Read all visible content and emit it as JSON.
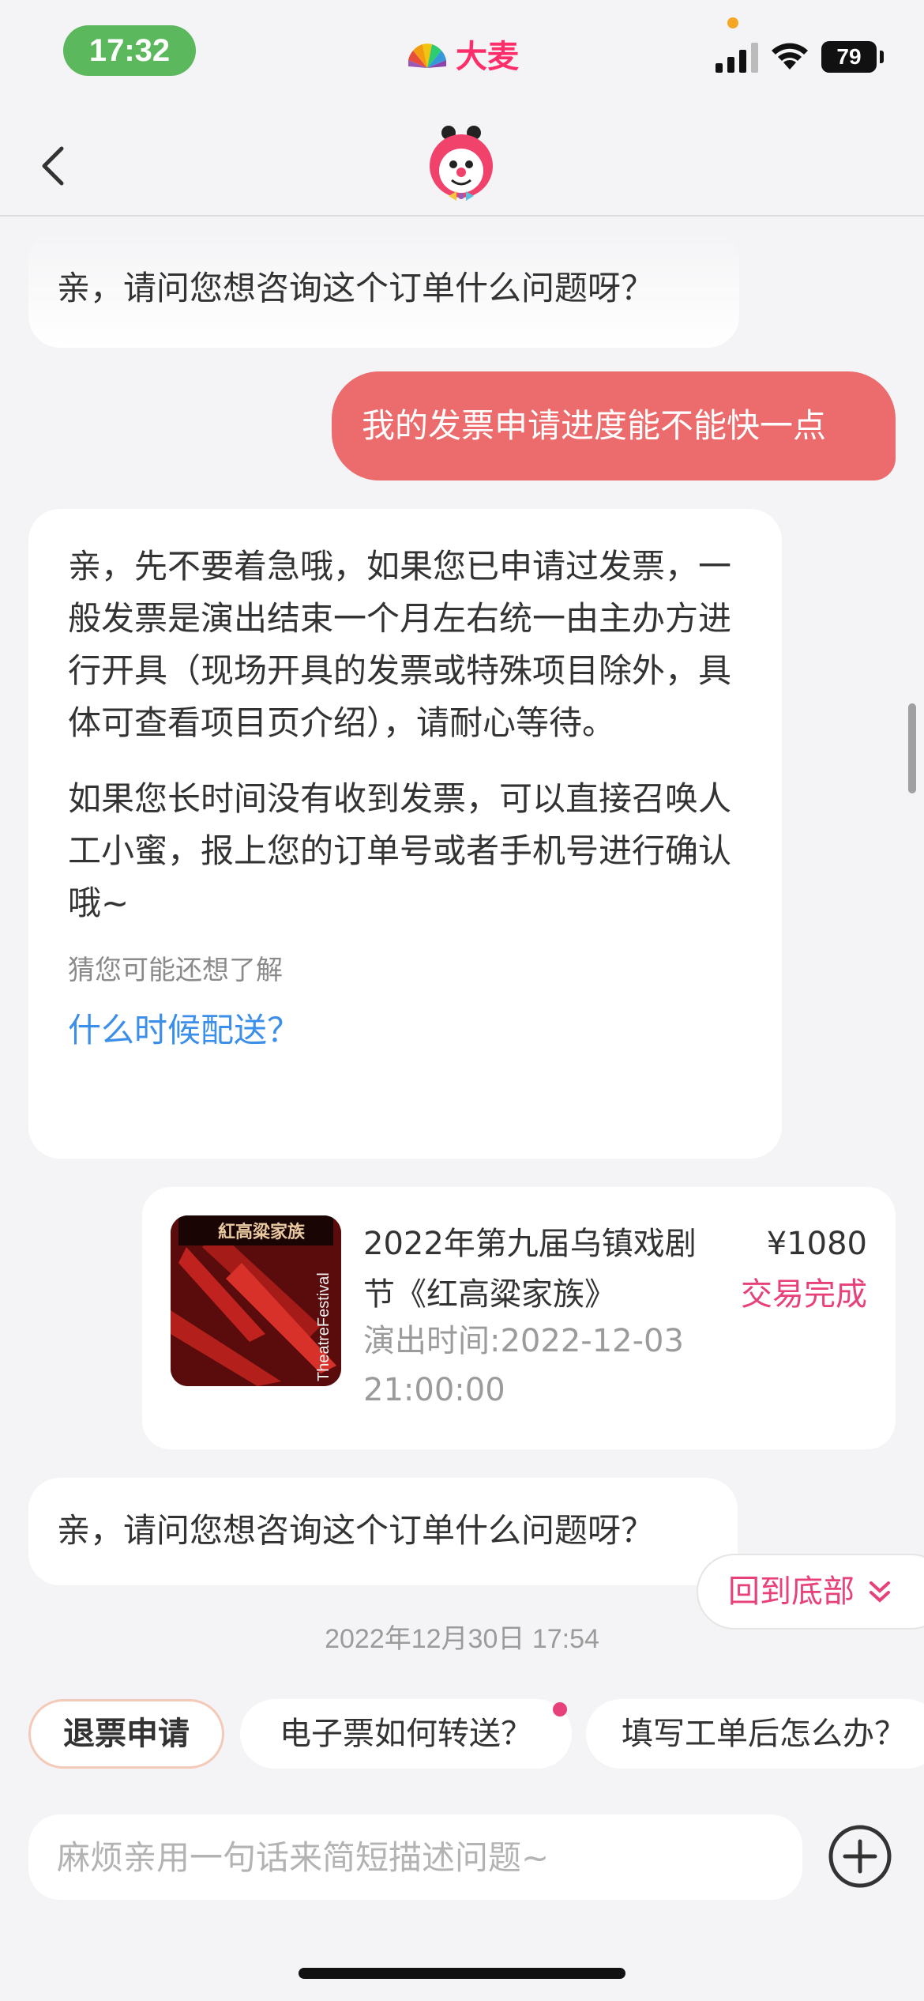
{
  "status_bar": {
    "time": "17:32",
    "brand": "大麦",
    "battery": "79"
  },
  "nav": {
    "back_icon": "chevron-left-icon",
    "mascot_icon": "damai-mascot-icon"
  },
  "messages": {
    "bot_1": "亲，请问您想咨询这个订单什么问题呀？",
    "user_1": "我的发票申请进度能不能快一点",
    "bot_2_p1": "亲，先不要着急哦，如果您已申请过发票，一般发票是演出结束一个月左右统一由主办方进行开具（现场开具的发票或特殊项目除外，具体可查看项目页介绍），请耐心等待。",
    "bot_2_p2": "如果您长时间没有收到发票，可以直接召唤人工小蜜，报上您的订单号或者手机号进行确认哦~",
    "bot_2_hint": "猜您可能还想了解",
    "bot_2_link": "什么时候配送？",
    "bot_3": "亲，请问您想咨询这个订单什么问题呀？"
  },
  "order": {
    "title": "2022年第九届乌镇戏剧节《红高粱家族》",
    "time": "演出时间:2022-12-03 21:00:00",
    "price": "¥1080",
    "status": "交易完成",
    "poster_text": "TheatreFestival"
  },
  "back_to_bottom": "回到底部",
  "timestamp": "2022年12月30日 17:54",
  "chips": [
    "退票申请",
    "电子票如何转送？",
    "填写工单后怎么办？"
  ],
  "input": {
    "placeholder": "麻烦亲用一句话来简短描述问题~"
  },
  "colors": {
    "user_bubble": "#ec6b6d",
    "accent_pink": "#e8407a",
    "link_blue": "#3b8ee9",
    "time_pill": "#5cb85c"
  }
}
